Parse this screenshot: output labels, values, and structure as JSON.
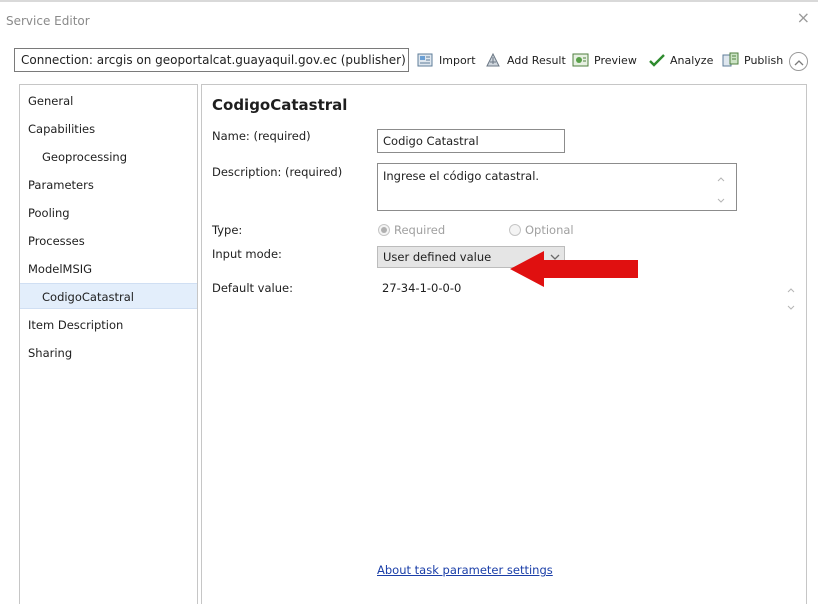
{
  "window": {
    "title": "Service Editor",
    "close_glyph": "×"
  },
  "toolbar": {
    "connection_text": "Connection: arcgis on geoportalcat.guayaquil.gov.ec (publisher) (...",
    "import_label": "Import",
    "add_result_label": "Add Result",
    "preview_label": "Preview",
    "analyze_label": "Analyze",
    "publish_label": "Publish",
    "collapse_glyph": "⌃"
  },
  "sidebar": {
    "items": [
      {
        "label": "General"
      },
      {
        "label": "Capabilities"
      },
      {
        "label": "Geoprocessing"
      },
      {
        "label": "Parameters"
      },
      {
        "label": "Pooling"
      },
      {
        "label": "Processes"
      },
      {
        "label": "ModelMSIG"
      },
      {
        "label": "CodigoCatastral"
      },
      {
        "label": "Item Description"
      },
      {
        "label": "Sharing"
      }
    ],
    "selected": "CodigoCatastral"
  },
  "main": {
    "heading": "CodigoCatastral",
    "name_label": "Name:  (required)",
    "name_value": "Codigo Catastral",
    "description_label": "Description:  (required)",
    "description_value": "Ingrese el código catastral.",
    "type_label": "Type:",
    "type_options": [
      {
        "label": "Required",
        "selected": true
      },
      {
        "label": "Optional",
        "selected": false
      }
    ],
    "input_mode_label": "Input mode:",
    "input_mode_value": "User defined value",
    "default_value_label": "Default value:",
    "default_value": "27-34-1-0-0-0",
    "help_link": "About task parameter settings"
  },
  "colors": {
    "selection_bg": "#e3eefb",
    "link": "#1a3ea8",
    "annotation_arrow": "#e01010",
    "analyze_check": "#2e8b2e"
  },
  "icons": [
    "import-icon",
    "add-result-icon",
    "preview-icon",
    "analyze-check-icon",
    "publish-icon",
    "collapse-icon",
    "close-icon",
    "dropdown-chevron-icon",
    "red-arrow-annotation"
  ]
}
